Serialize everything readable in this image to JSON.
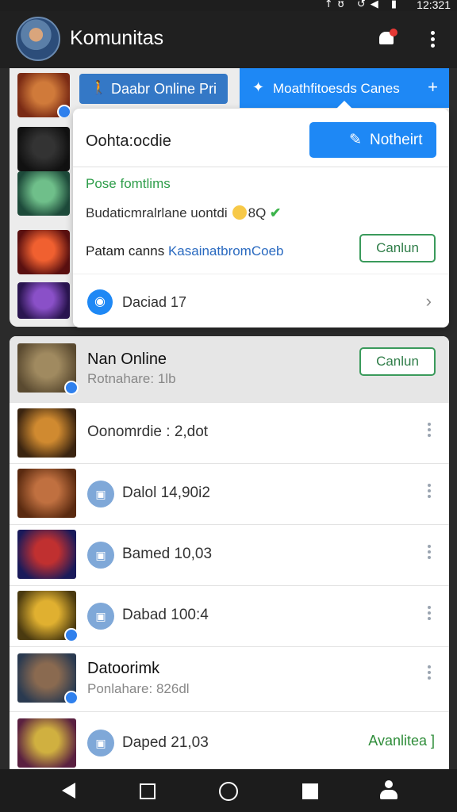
{
  "status_bar": {
    "icons": "↑ʊ ↺◀ ▮",
    "time": "12:321"
  },
  "app_bar": {
    "title": "Komunitas",
    "avatar_icon": "user-avatar",
    "bell_icon": "bell-icon",
    "more_icon": "more-vert-icon"
  },
  "tabs": {
    "online": {
      "label": "Daabr Online Pri",
      "icon": "person-walk-icon"
    },
    "games": {
      "label": "Moathfitoesds Canes",
      "icon": "sparkle-icon",
      "plus": "+"
    }
  },
  "side_thumbs": [
    {
      "colors": [
        "#7a2a14",
        "#d07a3a"
      ]
    },
    {
      "colors": [
        "#111111",
        "#333333"
      ]
    },
    {
      "colors": [
        "#1d4a3a",
        "#6fbf8a"
      ]
    },
    {
      "colors": [
        "#5a1010",
        "#f06030"
      ]
    },
    {
      "colors": [
        "#2a1550",
        "#8a50c8"
      ]
    }
  ],
  "popup": {
    "title": "Oohta:ocdie",
    "primary_button": "Notheirt",
    "section_label": "Pose fomtlims",
    "stat_text": "Budaticmralrlane uontdi",
    "stat_num": "8Q",
    "game_prefix": "Patam canns ",
    "game_link": "KasainatbromCoeb",
    "game_button": "Canlun",
    "discussion": "Daciad 17"
  },
  "list": [
    {
      "type": "game",
      "name": "Nan Online",
      "sub": "Rotnahare: 1lb",
      "action": "Canlun",
      "colors": [
        "#5a4a30",
        "#a08a60"
      ],
      "badge": true,
      "highlighted": true
    },
    {
      "type": "plain",
      "text": "Oonomrdie : 2,dot",
      "colors": [
        "#3a2410",
        "#d08a30"
      ],
      "badge": false
    },
    {
      "type": "count",
      "text": "Dalol 14,90i2",
      "colors": [
        "#5a2a10",
        "#c07040"
      ],
      "badge": false
    },
    {
      "type": "count",
      "text": "Bamed 10,03",
      "colors": [
        "#1a1a5a",
        "#c03030"
      ],
      "badge": false
    },
    {
      "type": "count",
      "text": "Dabad 100:4",
      "colors": [
        "#4a3a10",
        "#e0b030"
      ],
      "badge": true
    },
    {
      "type": "game",
      "name": "Datoorimk",
      "sub": "Ponlahare: 826dl",
      "colors": [
        "#2a3a50",
        "#8a6a50"
      ],
      "badge": true
    },
    {
      "type": "count",
      "text": "Daped 21,03",
      "action": "Avanlitea ]",
      "colors": [
        "#5a2040",
        "#d0b040"
      ],
      "badge": false
    }
  ],
  "nav": {
    "back": "back-icon",
    "recents": "square-icon",
    "home": "home-circle-icon",
    "apps": "square-filled-icon",
    "profile": "profile-icon"
  }
}
